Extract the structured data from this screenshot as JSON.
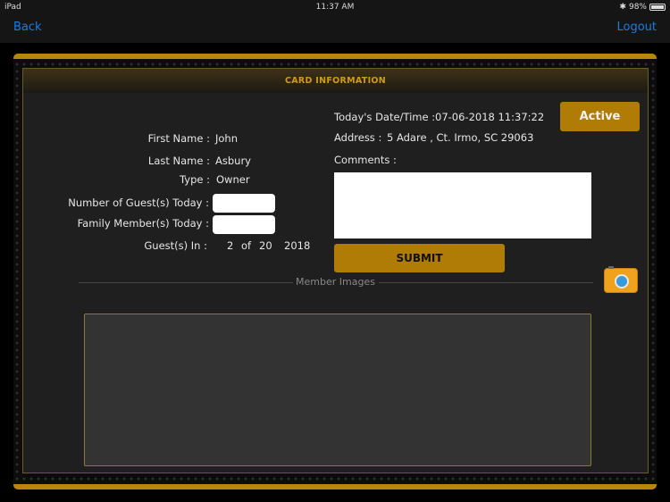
{
  "status_bar": {
    "device": "iPad",
    "time": "11:37 AM",
    "battery": "98%",
    "battery_level": 0.98
  },
  "nav": {
    "back": "Back",
    "logout": "Logout"
  },
  "card": {
    "title": "CARD INFORMATION",
    "status_button": "Active",
    "first_name_label": "First Name :",
    "first_name": "John",
    "last_name_label": "Last Name :",
    "last_name": "Asbury",
    "type_label": "Type :",
    "type": "Owner",
    "guests_today_label": "Number of Guest(s) Today :",
    "family_today_label": "Family Member(s) Today :",
    "guests_in_label": "Guest(s) In :",
    "guests_in_count": "2",
    "guests_in_of": "of",
    "guests_in_total": "20",
    "guests_in_year": "2018",
    "datetime_label": "Today's Date/Time :",
    "datetime": "07-06-2018 11:37:22",
    "address_label": "Address :",
    "address": "5 Adare , Ct. Irmo, SC 29063",
    "comments_label": "Comments :",
    "submit": "SUBMIT",
    "member_images_label": "Member Images"
  }
}
